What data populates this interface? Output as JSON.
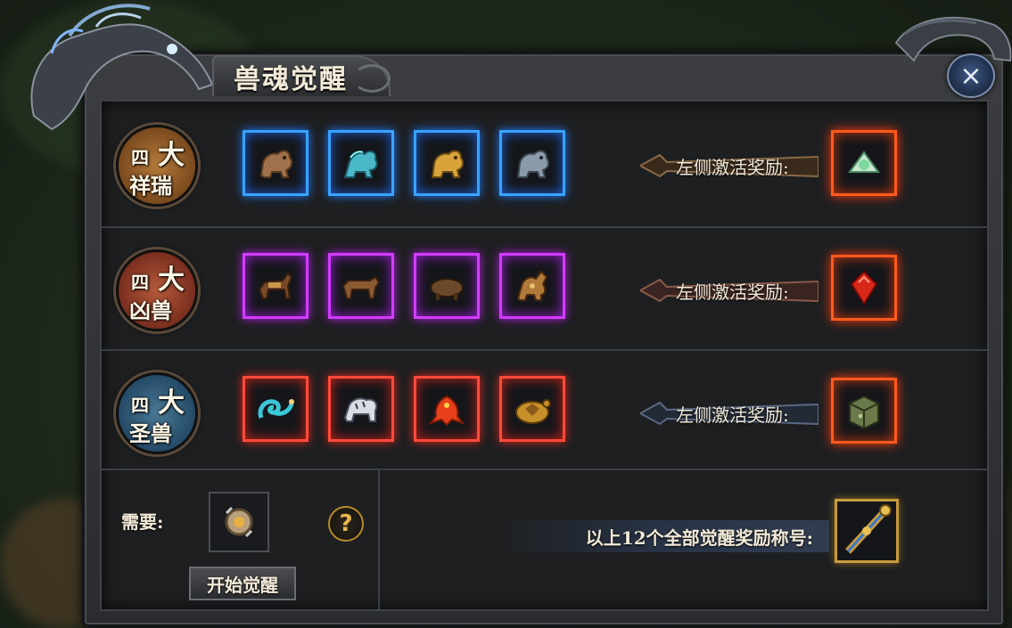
{
  "title": "兽魂觉醒",
  "close_icon": "×",
  "rows": [
    {
      "badge_top": "四",
      "badge_big": "大",
      "badge_bottom": "祥瑞",
      "slot_color": "blue",
      "items": [
        "bronze-beast-icon",
        "cyan-beast-icon",
        "gold-beast-icon",
        "silver-beast-icon"
      ],
      "reward_label": "左侧激活奖励:",
      "reward_icon": "jade-item-icon"
    },
    {
      "badge_top": "四",
      "badge_big": "大",
      "badge_bottom": "凶兽",
      "slot_color": "purple",
      "items": [
        "horse-beast-icon",
        "ox-beast-icon",
        "boar-beast-icon",
        "qilin-beast-icon"
      ],
      "reward_label": "左侧激活奖励:",
      "reward_icon": "red-gem-icon"
    },
    {
      "badge_top": "四",
      "badge_big": "大",
      "badge_bottom": "圣兽",
      "slot_color": "red",
      "items": [
        "azure-dragon-icon",
        "white-tiger-icon",
        "vermilion-bird-icon",
        "black-tortoise-icon"
      ],
      "reward_label": "左侧激活奖励:",
      "reward_icon": "bronze-cube-icon"
    }
  ],
  "bottom": {
    "need_label": "需要:",
    "need_item_icon": "awakening-stone-icon",
    "help_symbol": "?",
    "start_button": "开始觉醒",
    "final_reward_label": "以上12个全部觉醒奖励称号:",
    "final_reward_icon": "title-scepter-icon"
  },
  "colors": {
    "slot_blue": "#38a3ff",
    "slot_purple": "#d23cff",
    "slot_red": "#ff4a3a",
    "reward_orange": "#ff5a1e",
    "title_gold": "#c89b3c"
  }
}
